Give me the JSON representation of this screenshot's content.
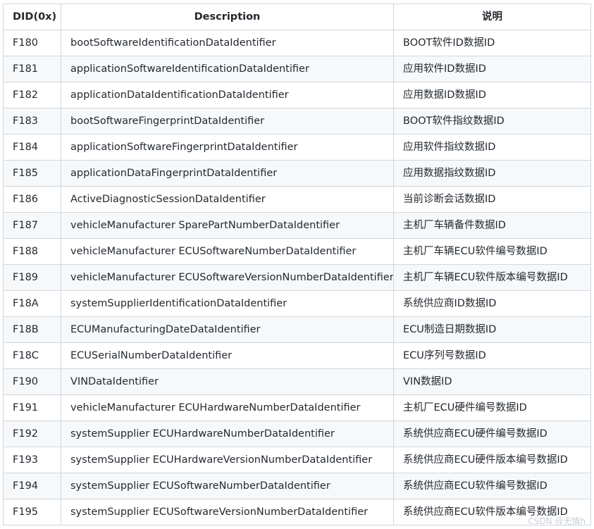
{
  "table": {
    "headers": [
      "DID(0x)",
      "Description",
      "说明"
    ],
    "rows": [
      [
        "F180",
        "bootSoftwareIdentificationDataIdentifier",
        "BOOT软件ID数据ID"
      ],
      [
        "F181",
        "applicationSoftwareIdentificationDataIdentifier",
        "应用软件ID数据ID"
      ],
      [
        "F182",
        "applicationDataIdentificationDataIdentifier",
        "应用数据ID数据ID"
      ],
      [
        "F183",
        "bootSoftwareFingerprintDataIdentifier",
        "BOOT软件指纹数据ID"
      ],
      [
        "F184",
        "applicationSoftwareFingerprintDataIdentifier",
        "应用软件指纹数据ID"
      ],
      [
        "F185",
        "applicationDataFingerprintDataIdentifier",
        "应用数据指纹数据ID"
      ],
      [
        "F186",
        "ActiveDiagnosticSessionDataIdentifier",
        "当前诊断会话数据ID"
      ],
      [
        "F187",
        "vehicleManufacturer SparePartNumberDataIdentifier",
        "主机厂车辆备件数据ID"
      ],
      [
        "F188",
        "vehicleManufacturer ECUSoftwareNumberDataIdentifier",
        "主机厂车辆ECU软件编号数据ID"
      ],
      [
        "F189",
        "vehicleManufacturer ECUSoftwareVersionNumberDataIdentifier",
        "主机厂车辆ECU软件版本编号数据ID"
      ],
      [
        "F18A",
        "systemSupplierIdentificationDataIdentifier",
        "系统供应商ID数据ID"
      ],
      [
        "F18B",
        "ECUManufacturingDateDataIdentifier",
        "ECU制造日期数据ID"
      ],
      [
        "F18C",
        "ECUSerialNumberDataIdentifier",
        "ECU序列号数据ID"
      ],
      [
        "F190",
        "VINDataIdentifier",
        "VIN数据ID"
      ],
      [
        "F191",
        "vehicleManufacturer ECUHardwareNumberDataIdentifier",
        "主机厂ECU硬件编号数据ID"
      ],
      [
        "F192",
        "systemSupplier ECUHardwareNumberDataIdentifier",
        "系统供应商ECU硬件编号数据ID"
      ],
      [
        "F193",
        "systemSupplier ECUHardwareVersionNumberDataIdentifier",
        "系统供应商ECU硬件版本编号数据ID"
      ],
      [
        "F194",
        "systemSupplier ECUSoftwareNumberDataIdentifier",
        "系统供应商ECU软件编号数据ID"
      ],
      [
        "F195",
        "systemSupplier ECUSoftwareVersionNumberDataIdentifier",
        "系统供应商ECU软件版本编号数据ID"
      ]
    ]
  },
  "watermark": "CSDN @无情h"
}
